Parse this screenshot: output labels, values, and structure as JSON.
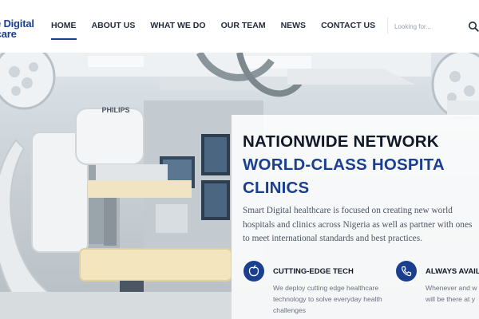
{
  "logo": {
    "line1": "e Digital",
    "line2": "hcare"
  },
  "nav": [
    {
      "label": "HOME",
      "active": true
    },
    {
      "label": "ABOUT US",
      "active": false
    },
    {
      "label": "WHAT WE DO",
      "active": false
    },
    {
      "label": "OUR TEAM",
      "active": false
    },
    {
      "label": "NEWS",
      "active": false
    },
    {
      "label": "CONTACT US",
      "active": false
    }
  ],
  "search": {
    "placeholder": "Looking for...",
    "icon": "search-icon"
  },
  "hero": {
    "image_brand_text": "PHILIPS",
    "heading_line1": "NATIONWIDE NETWORK",
    "heading_line2": "WORLD-CLASS HOSPITA",
    "heading_line3": "CLINICS",
    "description": "Smart Digital healthcare is focused on creating new world hospitals and clinics across Nigeria as well as partner with ones to meet international standards and best practices."
  },
  "features": [
    {
      "icon": "apple-icon",
      "title": "CUTTING-EDGE TECH",
      "text": "We deploy cutting edge healthcare technology to solve everyday health challenges"
    },
    {
      "icon": "phone-icon",
      "title": "ALWAYS AVAIL",
      "text": "Whenever and w need healthcare will be there at y"
    }
  ],
  "colors": {
    "brand_blue": "#1b3f8f",
    "heading_dark": "#111827"
  }
}
